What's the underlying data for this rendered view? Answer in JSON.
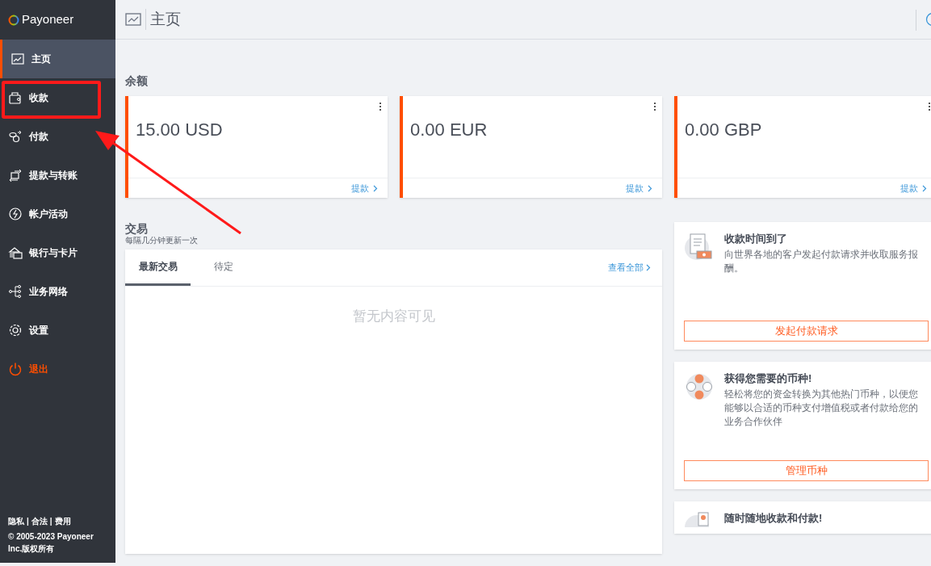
{
  "brand": "Payoneer",
  "nav": [
    {
      "label": "主页",
      "selected": true,
      "kind": "normal"
    },
    {
      "label": "收款",
      "selected": false,
      "kind": "normal"
    },
    {
      "label": "付款",
      "selected": false,
      "kind": "normal"
    },
    {
      "label": "提款与转账",
      "selected": false,
      "kind": "normal"
    },
    {
      "label": "帐户活动",
      "selected": false,
      "kind": "normal"
    },
    {
      "label": "银行与卡片",
      "selected": false,
      "kind": "normal"
    },
    {
      "label": "业务网络",
      "selected": false,
      "kind": "normal"
    },
    {
      "label": "设置",
      "selected": false,
      "kind": "normal"
    },
    {
      "label": "退出",
      "selected": false,
      "kind": "logout"
    }
  ],
  "footer": {
    "links": [
      "隐私",
      "合法",
      "费用"
    ],
    "separator": "|",
    "copyright": "© 2005-2023 Payoneer Inc.版权所有"
  },
  "page_title": "主页",
  "balances": {
    "heading": "余额",
    "cards": [
      {
        "amount": "15.00 USD",
        "link": "提款"
      },
      {
        "amount": "0.00 EUR",
        "link": "提款"
      },
      {
        "amount": "0.00 GBP",
        "link": "提款"
      }
    ]
  },
  "transactions": {
    "heading": "交易",
    "subtitle": "每隔几分钟更新一次",
    "tabs": [
      {
        "label": "最新交易",
        "selected": true
      },
      {
        "label": "待定",
        "selected": false
      }
    ],
    "view_all": "查看全部",
    "empty": "暂无内容可见"
  },
  "promos": [
    {
      "title": "收款时间到了",
      "text": "向世界各地的客户发起付款请求并收取服务报酬。",
      "button": "发起付款请求"
    },
    {
      "title": "获得您需要的币种!",
      "text": "轻松将您的资金转换为其他热门币种，以便您能够以合适的币种支付增值税或者付款给您的业务合作伙伴",
      "button": "管理币种"
    },
    {
      "title": "随时随地收款和付款!"
    }
  ]
}
